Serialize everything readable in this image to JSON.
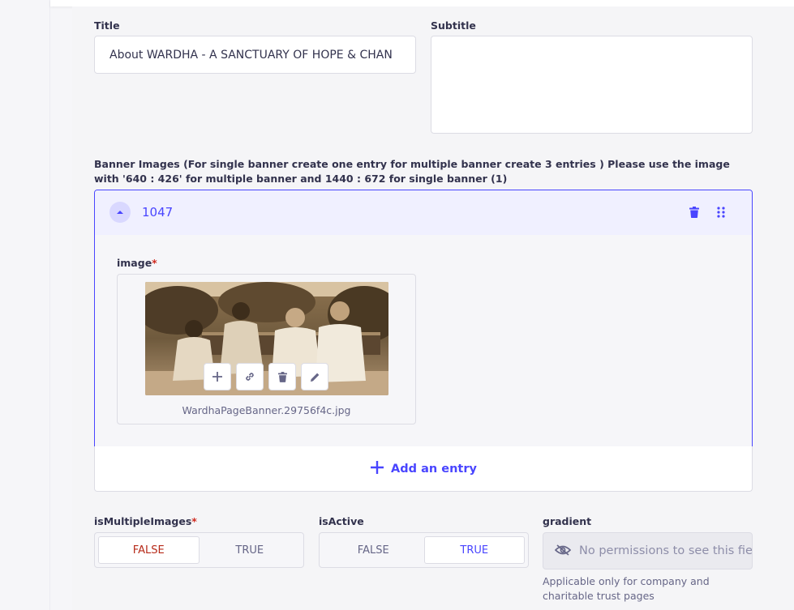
{
  "fields": {
    "title": {
      "label": "Title",
      "value": "About WARDHA - A SANCTUARY OF HOPE & CHAN"
    },
    "subtitle": {
      "label": "Subtitle",
      "value": ""
    }
  },
  "banner": {
    "label": "Banner Images (For single banner create one entry for multiple banner create 3 entries ) Please use the image with '640 : 426' for multiple banner and 1440 : 672 for single banner (1)",
    "entry": {
      "title": "1047",
      "image_label": "image",
      "required_mark": "*",
      "file_name": "WardhaPageBanner.29756f4c.jpg"
    },
    "add_entry_label": "Add an entry"
  },
  "booleans": {
    "isMultipleImages": {
      "label": "isMultipleImages",
      "required_mark": "*",
      "false_label": "FALSE",
      "true_label": "TRUE",
      "value": false
    },
    "isActive": {
      "label": "isActive",
      "false_label": "FALSE",
      "true_label": "TRUE",
      "value": true
    }
  },
  "gradient": {
    "label": "gradient",
    "placeholder": "No permissions to see this field",
    "hint": "Applicable only for company and charitable trust pages"
  },
  "icons": {
    "accordion_toggle": "chevron-up-icon",
    "delete": "trash-icon",
    "drag": "drag-handle-icon",
    "add": "plus-icon",
    "link": "link-icon",
    "edit": "pencil-icon",
    "no_permission": "eye-off-icon"
  },
  "colors": {
    "primary": "#4945ff",
    "danger": "#d02b20",
    "neutral_text": "#32324d",
    "muted_text": "#666687"
  }
}
